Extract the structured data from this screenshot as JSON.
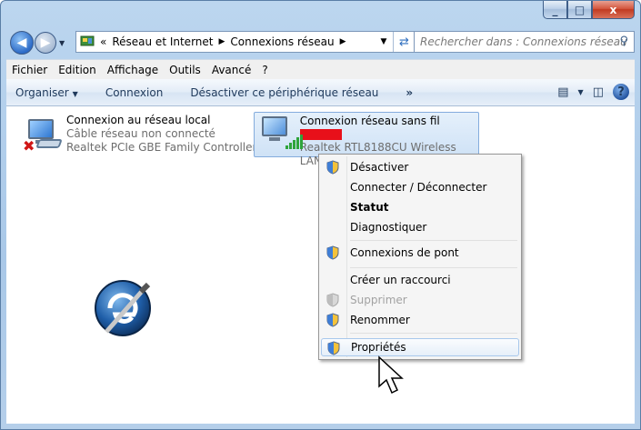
{
  "window": {
    "close": "x",
    "minimize": "_",
    "maximize": "□"
  },
  "address": {
    "prefix": "«",
    "crumbs": [
      "Réseau et Internet",
      "Connexions réseau"
    ],
    "search_placeholder": "Rechercher dans : Connexions réseau"
  },
  "menubar": [
    "Fichier",
    "Edition",
    "Affichage",
    "Outils",
    "Avancé",
    "?"
  ],
  "cmdbar": {
    "organize": "Organiser",
    "connect": "Connexion",
    "disable": "Désactiver ce périphérique réseau",
    "more": "»"
  },
  "connections": {
    "local": {
      "name": "Connexion au réseau local",
      "status": "Câble réseau non connecté",
      "device": "Realtek PCIe GBE Family Controller"
    },
    "wifi": {
      "name": "Connexion réseau sans fil",
      "device": "Realtek RTL8188CU Wireless LAN ..."
    }
  },
  "context_menu": {
    "items": [
      {
        "label": "Désactiver",
        "shield": true
      },
      {
        "label": "Connecter / Déconnecter",
        "shield": false
      },
      {
        "label": "Statut",
        "shield": false
      },
      {
        "label": "Diagnostiquer",
        "shield": false
      },
      {
        "label": "Connexions de pont",
        "shield": true
      },
      {
        "label": "Créer un raccourci",
        "shield": false
      },
      {
        "label": "Supprimer",
        "shield": true
      },
      {
        "label": "Renommer",
        "shield": true
      },
      {
        "label": "Propriétés",
        "shield": true
      }
    ]
  },
  "colors": {
    "accent": "#2d6bc7",
    "redact": "#e8101a",
    "signal": "#2ea43b"
  }
}
